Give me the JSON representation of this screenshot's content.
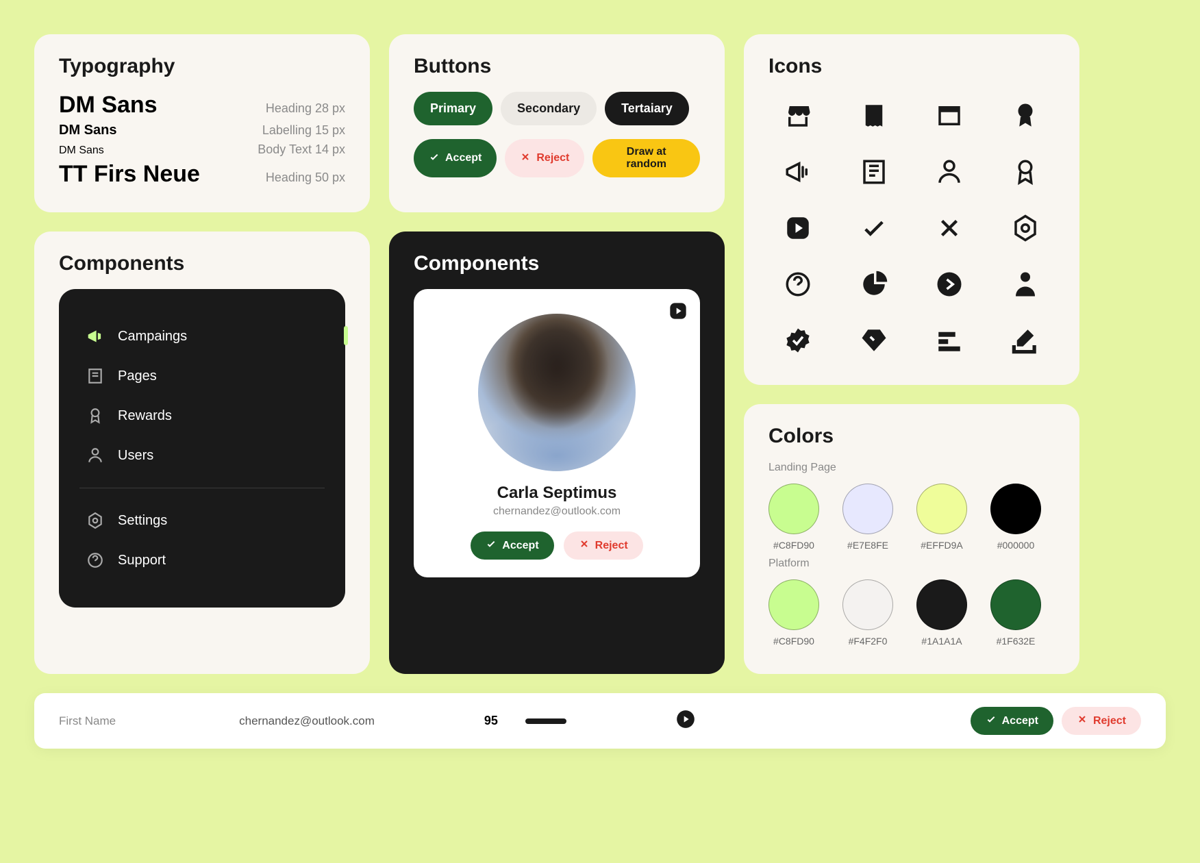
{
  "typography": {
    "title": "Typography",
    "rows": [
      {
        "family": "DM Sans",
        "spec": "Heading 28 px"
      },
      {
        "family": "DM Sans",
        "spec": "Labelling 15 px"
      },
      {
        "family": "DM Sans",
        "spec": "Body Text 14 px"
      },
      {
        "family": "TT Firs Neue",
        "spec": "Heading 50 px"
      }
    ]
  },
  "buttons": {
    "title": "Buttons",
    "primary": "Primary",
    "secondary": "Secondary",
    "tertiary": "Tertaiary",
    "accept": "Accept",
    "reject": "Reject",
    "random": "Draw at random"
  },
  "components_sidebar": {
    "title": "Components",
    "items": [
      {
        "icon": "megaphone-icon",
        "label": "Campaings",
        "active": true
      },
      {
        "icon": "page-icon",
        "label": "Pages"
      },
      {
        "icon": "ribbon-icon",
        "label": "Rewards"
      },
      {
        "icon": "user-icon",
        "label": "Users"
      }
    ],
    "footer_items": [
      {
        "icon": "gear-icon",
        "label": "Settings"
      },
      {
        "icon": "help-icon",
        "label": "Support"
      }
    ]
  },
  "components_profile": {
    "title": "Components",
    "name": "Carla Septimus",
    "email": "chernandez@outlook.com",
    "accept": "Accept",
    "reject": "Reject"
  },
  "icons": {
    "title": "Icons",
    "names": [
      "store-icon",
      "document-icon",
      "window-icon",
      "badge-solid-icon",
      "megaphone-icon",
      "page-icon",
      "user-icon",
      "ribbon-icon",
      "play-icon",
      "check-icon",
      "close-icon",
      "hex-gear-icon",
      "help-icon",
      "pie-icon",
      "arrow-circle-icon",
      "person-icon",
      "verified-icon",
      "diamond-icon",
      "bars-icon",
      "edit-icon"
    ]
  },
  "colors": {
    "title": "Colors",
    "groups": [
      {
        "label": "Landing Page",
        "swatches": [
          "#C8FD90",
          "#E7E8FE",
          "#EFFD9A",
          "#000000"
        ]
      },
      {
        "label": "Platform",
        "swatches": [
          "#C8FD90",
          "#F4F2F0",
          "#1A1A1A",
          "#1F632E"
        ]
      }
    ]
  },
  "bottom": {
    "first_name_label": "First Name",
    "email": "chernandez@outlook.com",
    "number": "95",
    "accept": "Accept",
    "reject": "Reject"
  }
}
